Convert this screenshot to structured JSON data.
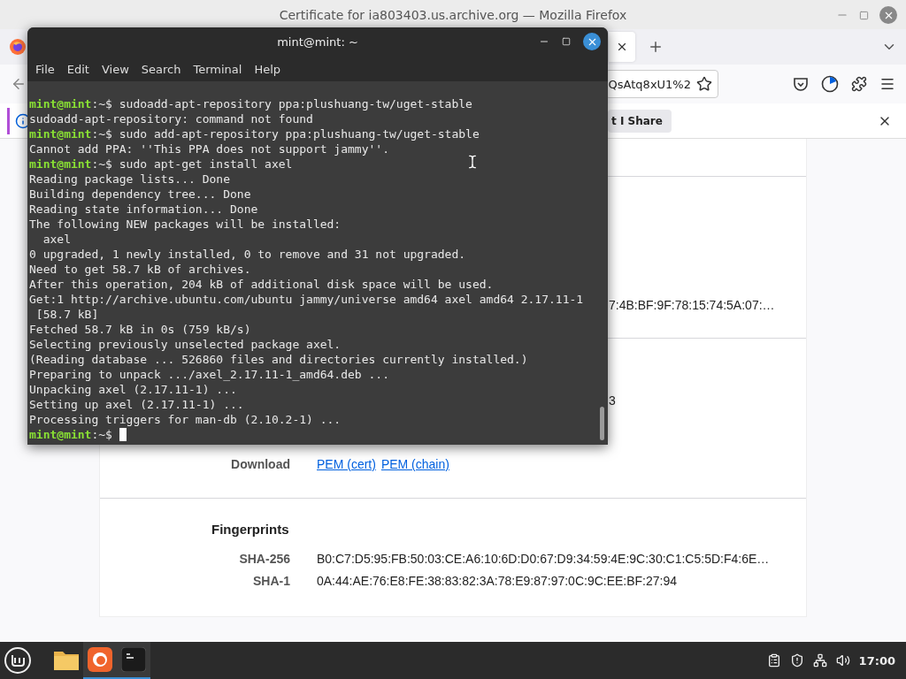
{
  "firefox": {
    "title": "Certificate for ia803403.us.archive.org — Mozilla Firefox",
    "url_fragment": "QsAtq8xU1%2",
    "notification_button": "t I Share",
    "cut_values": [
      {
        "text": "7:4B:BF:9F:78:15:74:5A:07:…"
      },
      {
        "text": "3"
      }
    ],
    "download": {
      "label": "Download",
      "links": [
        "PEM (cert)",
        "PEM (chain)"
      ]
    },
    "fingerprints": {
      "heading": "Fingerprints",
      "rows": [
        {
          "label": "SHA-256",
          "value": "B0:C7:D5:95:FB:50:03:CE:A6:10:6D:D0:67:D9:34:59:4E:9C:30:C1:C5:5D:F4:6E…"
        },
        {
          "label": "SHA-1",
          "value": "0A:44:AE:76:E8:FE:38:83:82:3A:78:E9:87:97:0C:9C:EE:BF:27:94"
        }
      ]
    }
  },
  "terminal": {
    "title": "mint@mint: ~",
    "menu": [
      "File",
      "Edit",
      "View",
      "Search",
      "Terminal",
      "Help"
    ],
    "lines": [
      {
        "kind": "prompt",
        "user": "mint@mint",
        "path": ":~$",
        "command": "sudoadd-apt-repository ppa:plushuang-tw/uget-stable"
      },
      {
        "kind": "output",
        "text": "sudoadd-apt-repository: command not found"
      },
      {
        "kind": "prompt",
        "user": "mint@mint",
        "path": ":~$",
        "command": "sudo add-apt-repository ppa:plushuang-tw/uget-stable"
      },
      {
        "kind": "output",
        "text": "Cannot add PPA: ''This PPA does not support jammy''."
      },
      {
        "kind": "prompt",
        "user": "mint@mint",
        "path": ":~$",
        "command": "sudo apt-get install axel"
      },
      {
        "kind": "output",
        "text": "Reading package lists... Done"
      },
      {
        "kind": "output",
        "text": "Building dependency tree... Done"
      },
      {
        "kind": "output",
        "text": "Reading state information... Done"
      },
      {
        "kind": "output",
        "text": "The following NEW packages will be installed:"
      },
      {
        "kind": "output",
        "text": "  axel"
      },
      {
        "kind": "output",
        "text": "0 upgraded, 1 newly installed, 0 to remove and 31 not upgraded."
      },
      {
        "kind": "output",
        "text": "Need to get 58.7 kB of archives."
      },
      {
        "kind": "output",
        "text": "After this operation, 204 kB of additional disk space will be used."
      },
      {
        "kind": "output",
        "text": "Get:1 http://archive.ubuntu.com/ubuntu jammy/universe amd64 axel amd64 2.17.11-1"
      },
      {
        "kind": "output",
        "text": " [58.7 kB]"
      },
      {
        "kind": "output",
        "text": "Fetched 58.7 kB in 0s (759 kB/s)"
      },
      {
        "kind": "output",
        "text": "Selecting previously unselected package axel."
      },
      {
        "kind": "output",
        "text": "(Reading database ... 526860 files and directories currently installed.)"
      },
      {
        "kind": "output",
        "text": "Preparing to unpack .../axel_2.17.11-1_amd64.deb ..."
      },
      {
        "kind": "output",
        "text": "Unpacking axel (2.17.11-1) ..."
      },
      {
        "kind": "output",
        "text": "Setting up axel (2.17.11-1) ..."
      },
      {
        "kind": "output",
        "text": "Processing triggers for man-db (2.10.2-1) ..."
      },
      {
        "kind": "prompt",
        "user": "mint@mint",
        "path": ":~$",
        "cursor": true
      }
    ]
  },
  "taskbar": {
    "apps": [
      {
        "kind": "folder",
        "active": false
      },
      {
        "kind": "firefox",
        "active": true
      },
      {
        "kind": "terminal",
        "active": true
      }
    ],
    "clock": "17:00"
  }
}
